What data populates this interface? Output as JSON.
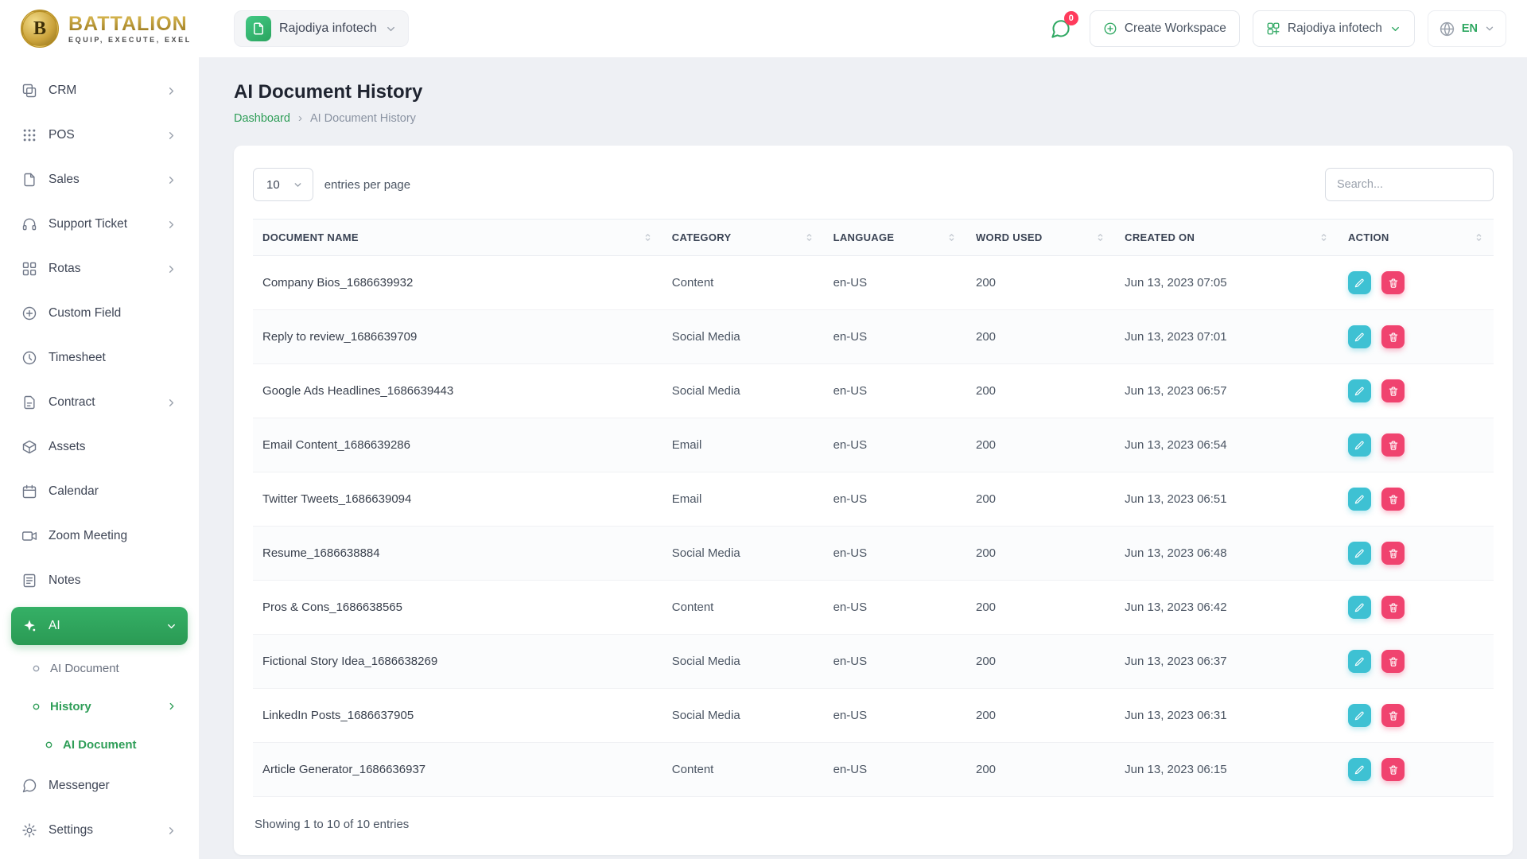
{
  "brand": {
    "name": "BATTALION",
    "tagline": "EQUIP, EXECUTE, EXEL",
    "initial": "B"
  },
  "header": {
    "workspace_label": "Rajodiya infotech",
    "chat_badge": "0",
    "create_workspace_label": "Create Workspace",
    "account_label": "Rajodiya infotech",
    "language_label": "EN"
  },
  "sidebar": {
    "items": [
      {
        "label": "CRM"
      },
      {
        "label": "POS"
      },
      {
        "label": "Sales"
      },
      {
        "label": "Support Ticket"
      },
      {
        "label": "Rotas"
      },
      {
        "label": "Custom Field"
      },
      {
        "label": "Timesheet"
      },
      {
        "label": "Contract"
      },
      {
        "label": "Assets"
      },
      {
        "label": "Calendar"
      },
      {
        "label": "Zoom Meeting"
      },
      {
        "label": "Notes"
      },
      {
        "label": "AI"
      },
      {
        "label": "AI Document"
      },
      {
        "label": "History"
      },
      {
        "label": "AI Document"
      },
      {
        "label": "Messenger"
      },
      {
        "label": "Settings"
      }
    ]
  },
  "page": {
    "title": "AI Document History",
    "breadcrumb": {
      "home": "Dashboard",
      "current": "AI Document History"
    }
  },
  "controls": {
    "page_size": "10",
    "entries_label": "entries per page",
    "search_placeholder": "Search..."
  },
  "table": {
    "columns": [
      {
        "label": "DOCUMENT NAME"
      },
      {
        "label": "CATEGORY"
      },
      {
        "label": "LANGUAGE"
      },
      {
        "label": "WORD USED"
      },
      {
        "label": "CREATED ON"
      },
      {
        "label": "ACTION"
      }
    ],
    "rows": [
      {
        "name": "Company Bios_1686639932",
        "category": "Content",
        "language": "en-US",
        "words": "200",
        "created": "Jun 13, 2023 07:05"
      },
      {
        "name": "Reply to review_1686639709",
        "category": "Social Media",
        "language": "en-US",
        "words": "200",
        "created": "Jun 13, 2023 07:01"
      },
      {
        "name": "Google Ads Headlines_1686639443",
        "category": "Social Media",
        "language": "en-US",
        "words": "200",
        "created": "Jun 13, 2023 06:57"
      },
      {
        "name": "Email Content_1686639286",
        "category": "Email",
        "language": "en-US",
        "words": "200",
        "created": "Jun 13, 2023 06:54"
      },
      {
        "name": "Twitter Tweets_1686639094",
        "category": "Email",
        "language": "en-US",
        "words": "200",
        "created": "Jun 13, 2023 06:51"
      },
      {
        "name": "Resume_1686638884",
        "category": "Social Media",
        "language": "en-US",
        "words": "200",
        "created": "Jun 13, 2023 06:48"
      },
      {
        "name": "Pros & Cons_1686638565",
        "category": "Content",
        "language": "en-US",
        "words": "200",
        "created": "Jun 13, 2023 06:42"
      },
      {
        "name": "Fictional Story Idea_1686638269",
        "category": "Social Media",
        "language": "en-US",
        "words": "200",
        "created": "Jun 13, 2023 06:37"
      },
      {
        "name": "LinkedIn Posts_1686637905",
        "category": "Social Media",
        "language": "en-US",
        "words": "200",
        "created": "Jun 13, 2023 06:31"
      },
      {
        "name": "Article Generator_1686636937",
        "category": "Content",
        "language": "en-US",
        "words": "200",
        "created": "Jun 13, 2023 06:15"
      }
    ],
    "summary": "Showing 1 to 10 of 10 entries"
  },
  "colors": {
    "accent_green": "#2f9e58",
    "edit_teal": "#3ec1d3",
    "delete_pink": "#f0436f",
    "badge_red": "#ff3b5c",
    "brand_gold": "#b99124"
  }
}
